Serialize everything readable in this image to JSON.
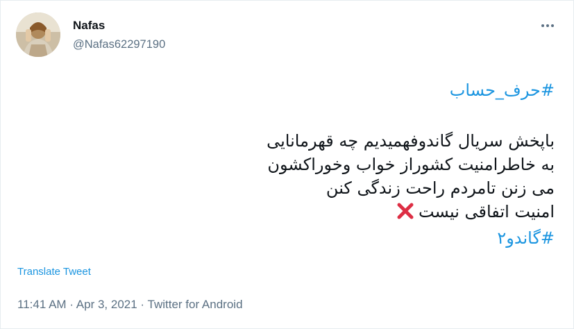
{
  "tweet": {
    "author_name": "Nafas",
    "author_handle": "@Nafas62297190",
    "hashtag_1": "#حرف_حساب",
    "lines": [
      "باپخش سریال گاندوفهمیدیم چه قهرمانایی",
      "به خاطرامنیت کشوراز خواب وخوراکشون",
      "می زنن تامردم راحت زندگی کنن",
      "امنیت اتفاقی نیست"
    ],
    "emoji_name": "cross-mark-icon",
    "hashtag_2": "#گاندو۲",
    "translate_label": "Translate Tweet",
    "time": "11:41 AM",
    "separator": "·",
    "date": "Apr 3, 2021",
    "source": "Twitter for Android"
  },
  "colors": {
    "link": "#1b95e0",
    "secondary": "#5b7083",
    "text": "#0f1419",
    "cross": "#dd2e44"
  }
}
